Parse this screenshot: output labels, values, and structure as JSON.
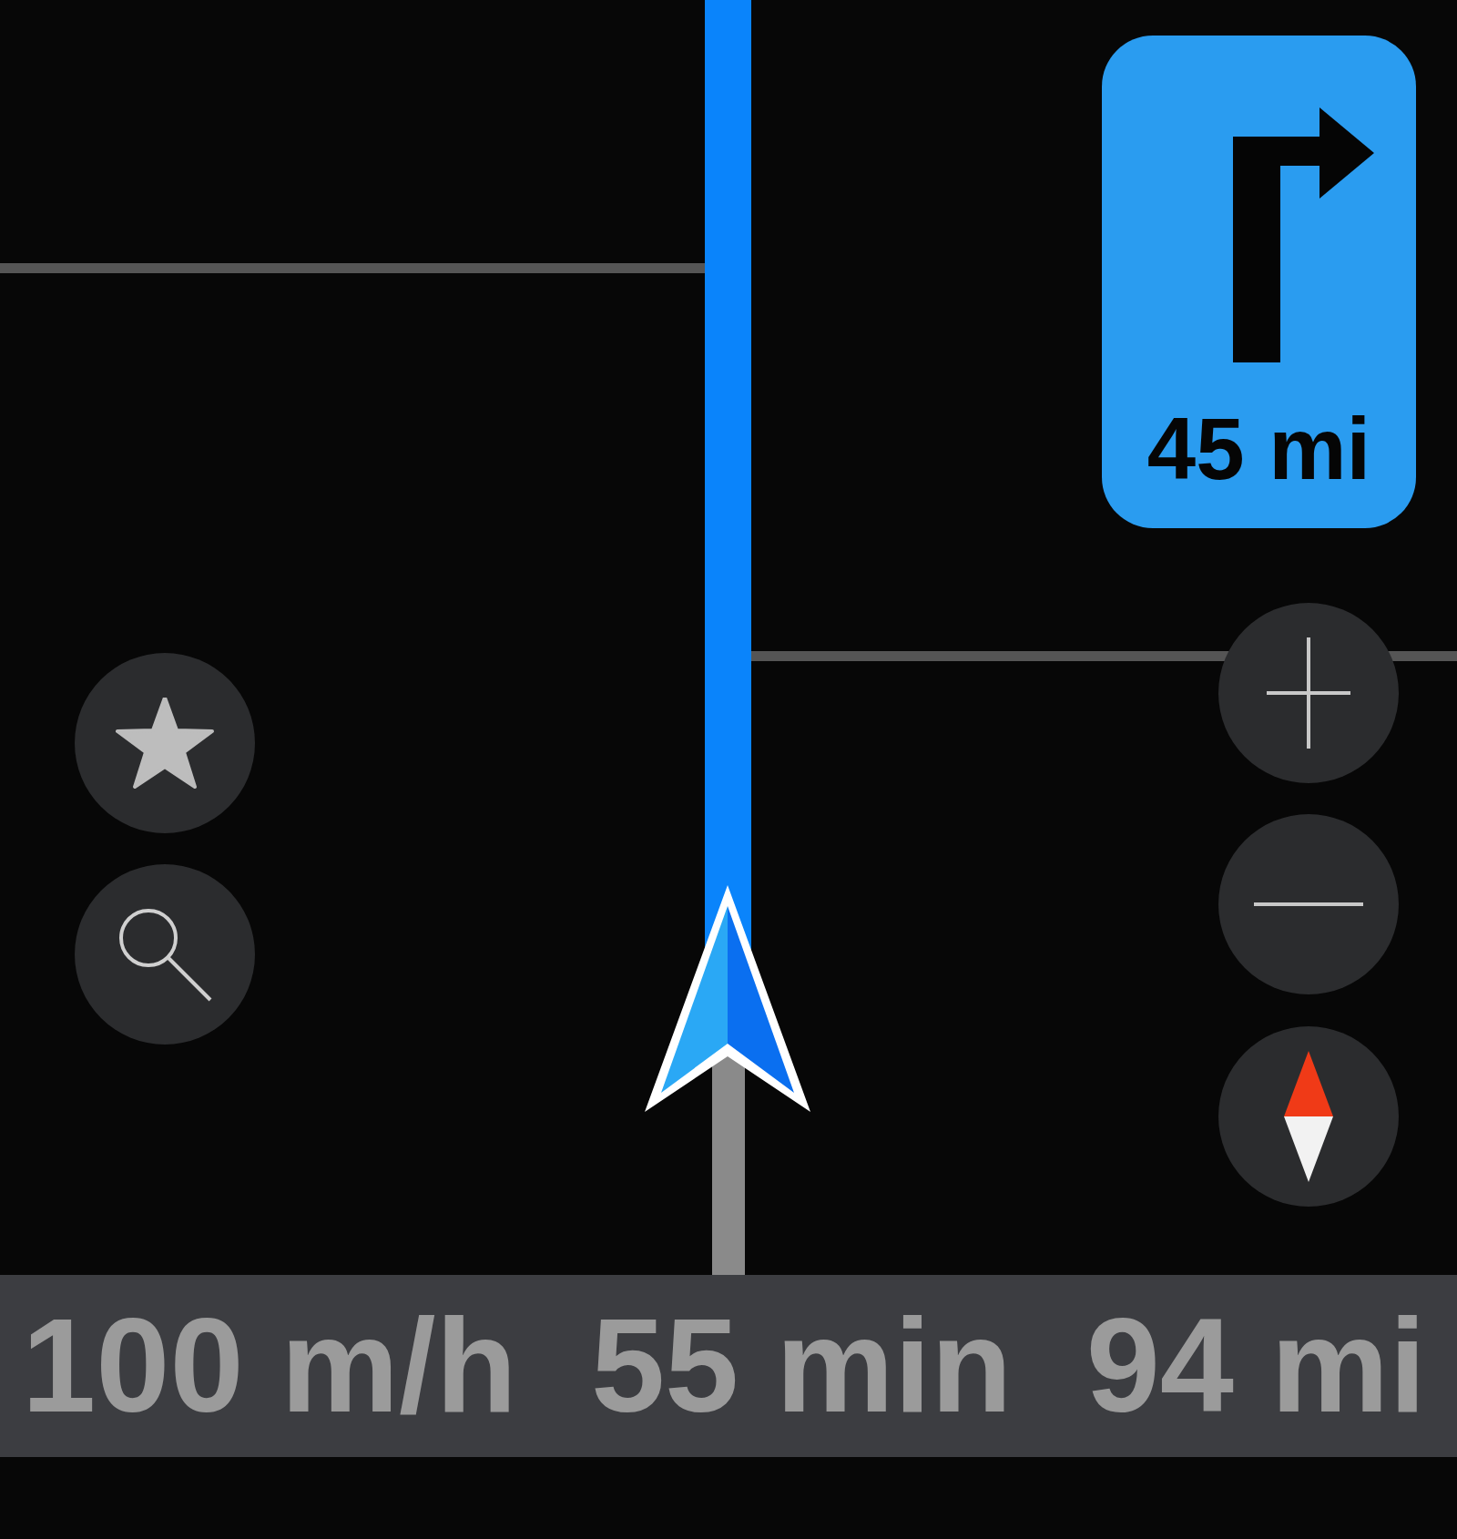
{
  "turn_instruction": {
    "distance": "45 mi"
  },
  "trip_bar": {
    "speed": "100 m/h",
    "time_remaining": "55 min",
    "distance_remaining": "94 mi"
  }
}
